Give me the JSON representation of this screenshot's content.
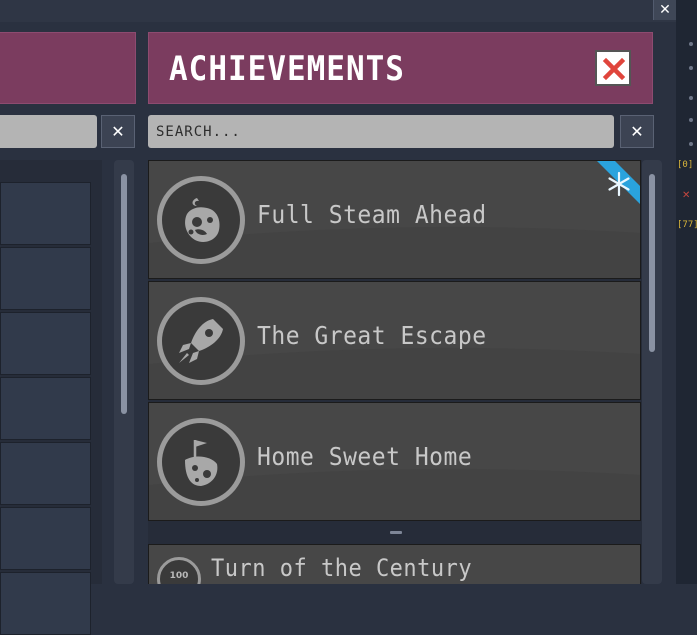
{
  "window": {
    "close_symbol": "✕"
  },
  "left_panel": {
    "search_clear_symbol": "✕"
  },
  "achievements_panel": {
    "title": "ACHIEVEMENTS",
    "close_icon": "close-x-icon",
    "search": {
      "placeholder": "SEARCH...",
      "value": "",
      "clear_symbol": "✕"
    },
    "items": [
      {
        "name": "Full Steam Ahead",
        "icon": "asteroid-icon",
        "seasonal_icon": "snowflake-icon"
      },
      {
        "name": "The Great Escape",
        "icon": "rocket-icon"
      },
      {
        "name": "Home Sweet Home",
        "icon": "flag-planet-icon"
      },
      {
        "name": "Turn of the Century",
        "icon": "cycle-100-icon",
        "badge_text": "100"
      }
    ]
  },
  "background": {
    "glyph_1": "[0]",
    "glyph_2": "[77]",
    "glyph_3": "✕"
  },
  "colors": {
    "header": "#7b3c5f",
    "card": "#474747",
    "close_x": "#e0453c",
    "ribbon": "#2aa3dd"
  }
}
